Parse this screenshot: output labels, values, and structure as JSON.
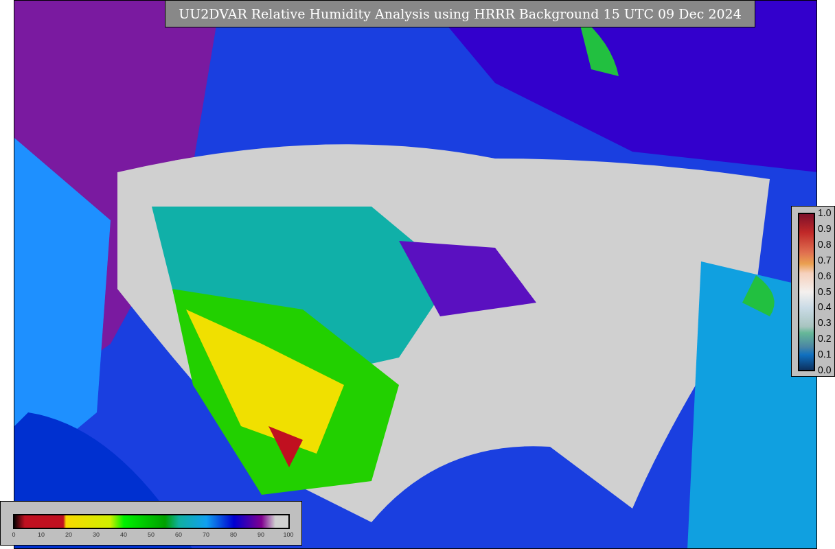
{
  "title": "UU2DVAR Relative Humidity Analysis using HRRR Background 15 UTC 09 Dec 2024",
  "side_colorbar": {
    "ticks": [
      "1.0",
      "0.9",
      "0.8",
      "0.7",
      "0.6",
      "0.5",
      "0.4",
      "0.3",
      "0.2",
      "0.1",
      "0.0"
    ]
  },
  "bottom_colorbar": {
    "ticks": [
      "0",
      "10",
      "20",
      "30",
      "40",
      "50",
      "60",
      "70",
      "80",
      "90",
      "100"
    ]
  }
}
